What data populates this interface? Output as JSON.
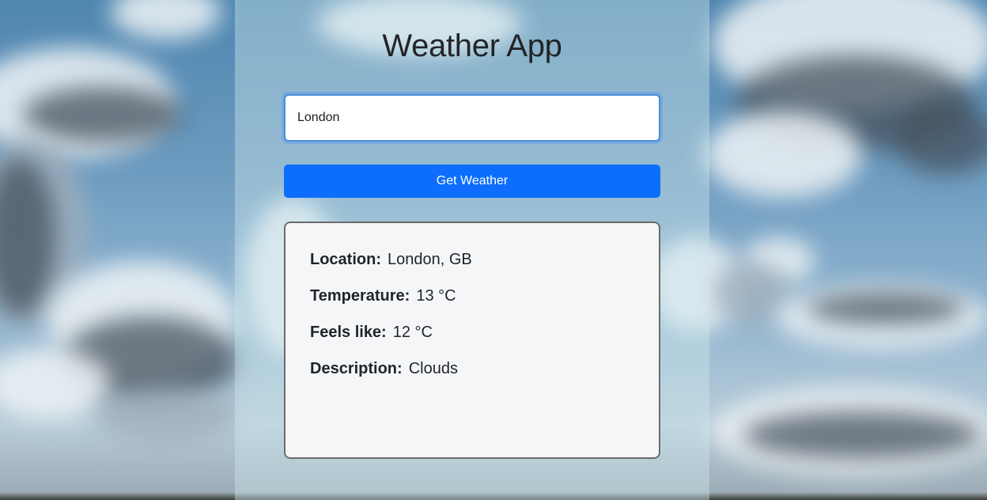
{
  "app": {
    "title": "Weather App"
  },
  "search": {
    "value": "London",
    "button_label": "Get Weather"
  },
  "result": {
    "location_label": "Location:",
    "location_value": "London, GB",
    "temperature_label": "Temperature:",
    "temperature_value": "13 °C",
    "feels_like_label": "Feels like:",
    "feels_like_value": "12 °C",
    "description_label": "Description:",
    "description_value": "Clouds"
  },
  "colors": {
    "button": "#0d6efd",
    "input_focus_border": "#4a90d9",
    "result_border": "#6b6b6b",
    "panel_overlay": "rgba(205,230,235,0.42)"
  }
}
